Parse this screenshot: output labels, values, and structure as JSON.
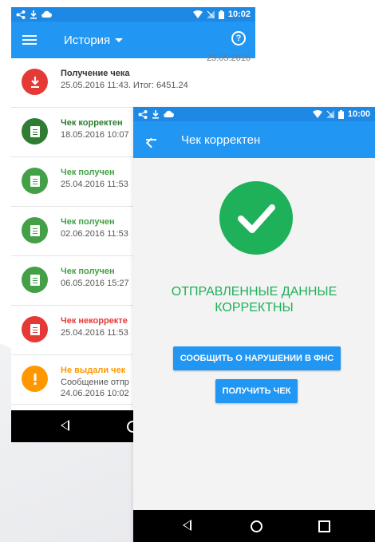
{
  "phone1": {
    "status": {
      "time": "10:02"
    },
    "appbar": {
      "title": "История"
    },
    "list": [
      {
        "title": "Получение чека",
        "line1": "25.05.2016 11:43.  Итог: 6451.24",
        "top_date": "25.05.2016",
        "color": "#e53935",
        "title_color": "#333333",
        "icon": "download-icon"
      },
      {
        "title": "Чек корректен",
        "line1": "18.05.2016 10:07",
        "color": "#2e7d32",
        "title_color": "#2e7d32",
        "icon": "receipt-icon"
      },
      {
        "title": "Чек получен",
        "line1": "25.04.2016 11:53",
        "color": "#43a047",
        "title_color": "#43a047",
        "icon": "receipt-icon"
      },
      {
        "title": "Чек получен",
        "line1": "02.06.2016 11:53",
        "color": "#43a047",
        "title_color": "#43a047",
        "icon": "receipt-icon"
      },
      {
        "title": "Чек получен",
        "line1": "06.05.2016 15:27",
        "color": "#43a047",
        "title_color": "#43a047",
        "icon": "receipt-icon"
      },
      {
        "title": "Чек некорректе",
        "line1": "25.04.2016 11:53",
        "color": "#e53935",
        "title_color": "#e53935",
        "icon": "receipt-icon"
      },
      {
        "title": "Не выдали чек",
        "line1": "Сообщение отпр",
        "line2": "24.06.2016 10:02",
        "color": "#ff9800",
        "title_color": "#ff9800",
        "icon": "alert-icon"
      }
    ]
  },
  "phone2": {
    "status": {
      "time": "10:00"
    },
    "appbar": {
      "title": "Чек корректен"
    },
    "message_line1": "ОТПРАВЛЕННЫЕ ДАННЫЕ",
    "message_line2": "КОРРЕКТНЫ",
    "report_button": "СООБЩИТЬ О НАРУШЕНИИ В ФНС",
    "get_button": "ПОЛУЧИТЬ ЧЕК"
  },
  "colors": {
    "primary": "#2196f3",
    "success": "#1eb15a",
    "error": "#e53935",
    "warning": "#ff9800"
  }
}
